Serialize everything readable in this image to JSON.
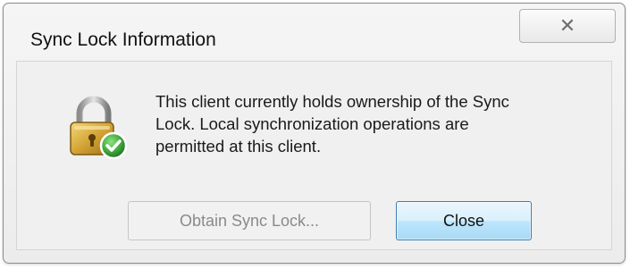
{
  "window": {
    "title": "Sync Lock Information",
    "close_glyph": "✕"
  },
  "message": {
    "lines": [
      "This client currently holds ownership of the Sync",
      "Lock. Local synchronization operations are",
      "permitted at this client."
    ]
  },
  "buttons": {
    "obtain_label": "Obtain Sync Lock...",
    "obtain_enabled": false,
    "close_label": "Close"
  },
  "icons": {
    "main": "padlock-with-green-check-icon",
    "title_close": "close-icon"
  },
  "colors": {
    "lock_gold": "#c99a2e",
    "check_green": "#3ea33b",
    "close_button_border": "#3c7fb1"
  }
}
